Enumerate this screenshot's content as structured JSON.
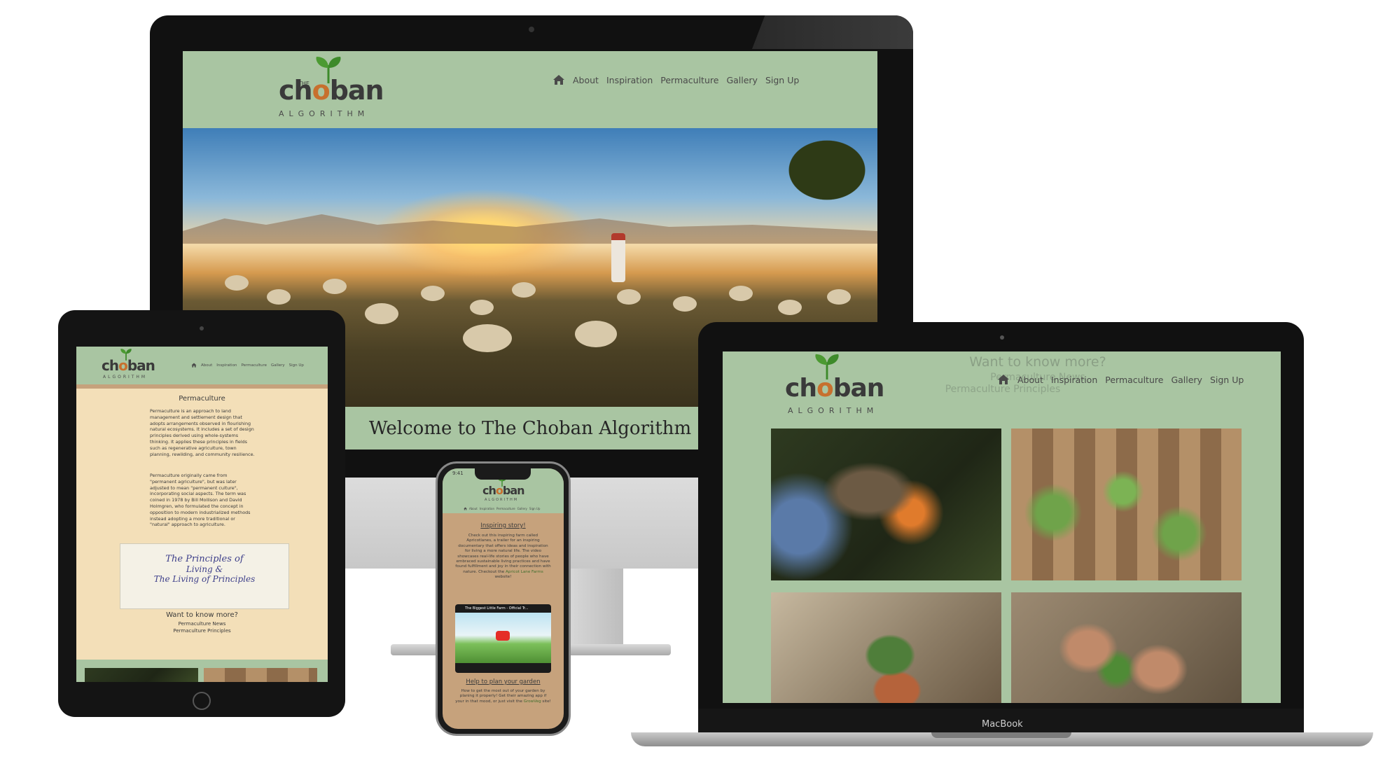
{
  "site": {
    "logo_top": "THE",
    "logo_word_pre": "ch",
    "logo_word_o": "o",
    "logo_word_post": "ban",
    "logo_sub": "ALGORITHM"
  },
  "nav": {
    "items": [
      "About",
      "Inspiration",
      "Permaculture",
      "Gallery",
      "Sign Up"
    ]
  },
  "desktop": {
    "welcome": "Welcome to The Choban Algorithm"
  },
  "laptop": {
    "overlay_title": "Want to know more?",
    "overlay_link1": "Permaculture News",
    "overlay_link2": "Permaculture Principles",
    "brand_label": "MacBook"
  },
  "tablet": {
    "heading": "Permaculture",
    "para1": "Permaculture is an approach to land management and settlement design that adopts arrangements observed in flourishing natural ecosystems. It includes a set of design principles derived using whole-systems thinking. It applies these principles in fields such as regenerative agriculture, town planning, rewilding, and community resilience.",
    "para2": "Permaculture originally came from \"permanent agriculture\", but was later adjusted to mean \"permanent culture\", incorporating social aspects. The term was coined in 1978 by Bill Mollison and David Holmgren, who formulated the concept in opposition to modern industrialized methods instead adopting a more traditional or \"natural\" approach to agriculture.",
    "poster_line1": "The Principles of",
    "poster_line2": "Living &",
    "poster_line3": "The Living of Principles",
    "more_title": "Want to know more?",
    "link1": "Permaculture News",
    "link2": "Permaculture Principles"
  },
  "phone": {
    "time": "9:41",
    "story_title": "Inspiring story!",
    "story_text": "Check out this inspiring farm called Apricotlanes, a trailer for an inspiring documentary that offers ideas and inspiration for living a more natural life. The video showcases real-life stories of people who have embraced sustainable living practices and have found fulfillment and joy in their connection with nature. Checkout the",
    "story_link": "Apricot Lane Farms",
    "story_end": "website!",
    "video_title": "The Biggest Little Farm - Official Tr...",
    "plan_title": "Help to plan your garden",
    "plan_text": "How to get the most out of your garden by planing it properly! Get their amazing app if your in that mood, or just visit the",
    "plan_link": "GrowVeg",
    "plan_end": "site!"
  },
  "colors": {
    "sage": "#a9c5a2",
    "sand": "#f3dfb8",
    "tan": "#c6a27c",
    "orange": "#c7702e",
    "leaf": "#3d8a2a"
  }
}
